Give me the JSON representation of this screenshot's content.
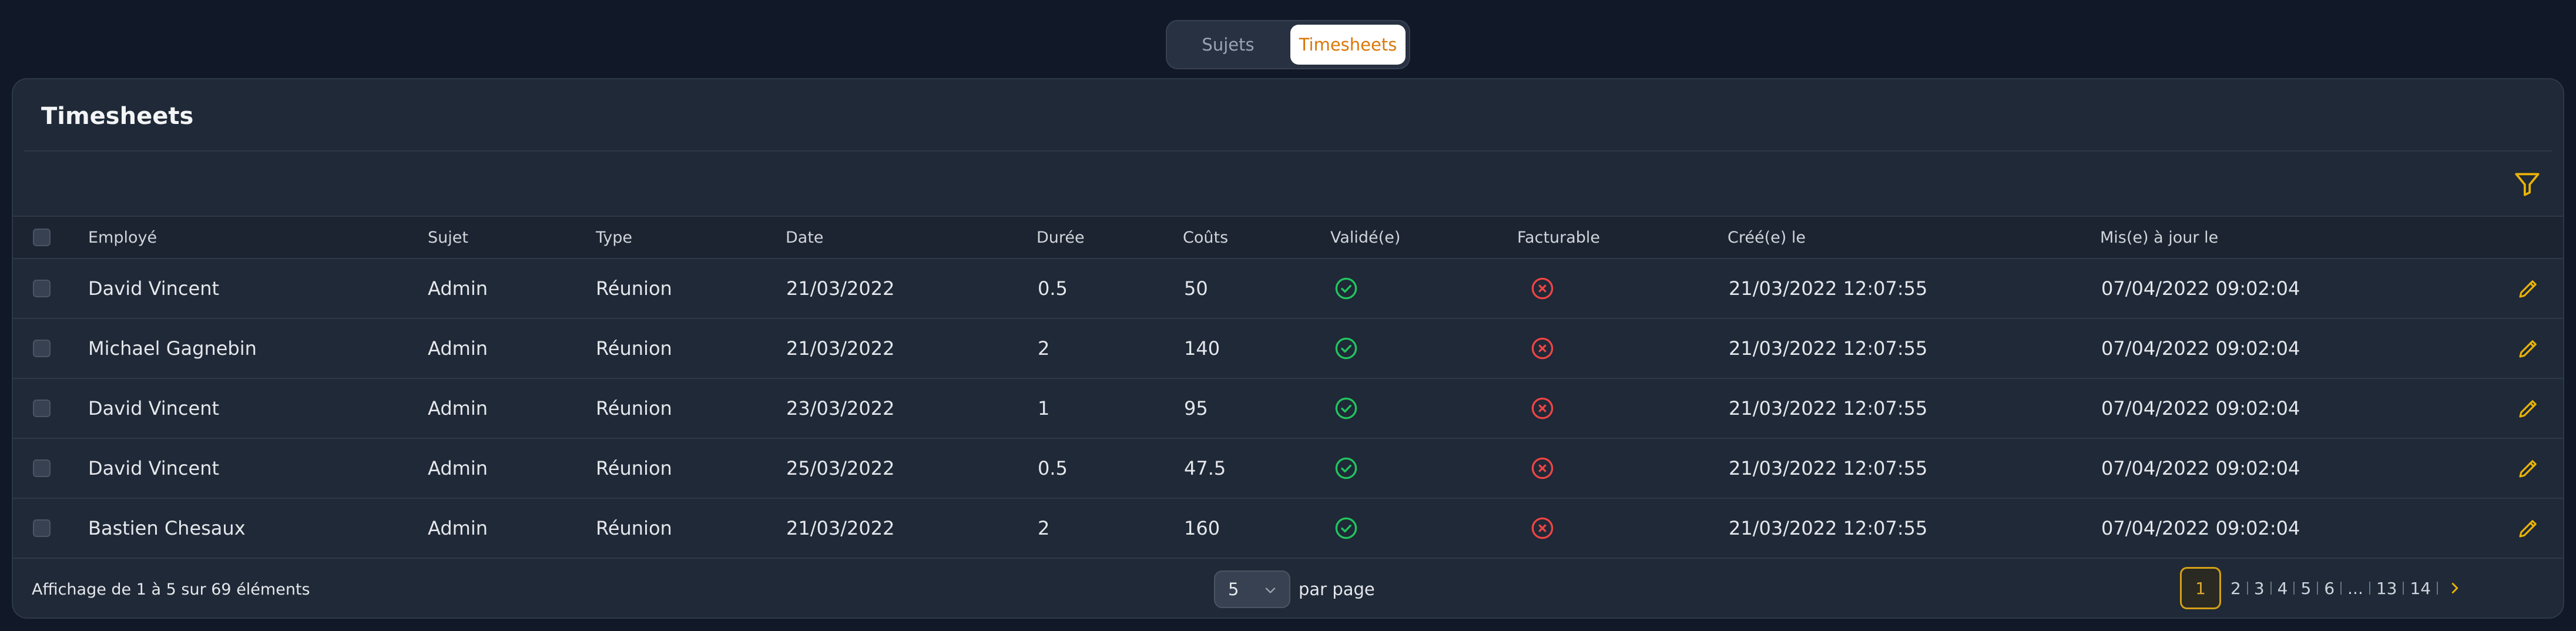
{
  "tabs": [
    {
      "label": "Sujets",
      "active": false
    },
    {
      "label": "Timesheets",
      "active": true
    }
  ],
  "card": {
    "title": "Timesheets"
  },
  "table": {
    "columns": [
      "Employé",
      "Sujet",
      "Type",
      "Date",
      "Durée",
      "Coûts",
      "Validé(e)",
      "Facturable",
      "Créé(e) le",
      "Mis(e) à jour le"
    ],
    "rows": [
      {
        "employe": "David Vincent",
        "sujet": "Admin",
        "type": "Réunion",
        "date": "21/03/2022",
        "duree": "0.5",
        "couts": "50",
        "cree": "21/03/2022 12:07:55",
        "maj": "07/04/2022 09:02:04"
      },
      {
        "employe": "Michael Gagnebin",
        "sujet": "Admin",
        "type": "Réunion",
        "date": "21/03/2022",
        "duree": "2",
        "couts": "140",
        "cree": "21/03/2022 12:07:55",
        "maj": "07/04/2022 09:02:04"
      },
      {
        "employe": "David Vincent",
        "sujet": "Admin",
        "type": "Réunion",
        "date": "23/03/2022",
        "duree": "1",
        "couts": "95",
        "cree": "21/03/2022 12:07:55",
        "maj": "07/04/2022 09:02:04"
      },
      {
        "employe": "David Vincent",
        "sujet": "Admin",
        "type": "Réunion",
        "date": "25/03/2022",
        "duree": "0.5",
        "couts": "47.5",
        "cree": "21/03/2022 12:07:55",
        "maj": "07/04/2022 09:02:04"
      },
      {
        "employe": "Bastien Chesaux",
        "sujet": "Admin",
        "type": "Réunion",
        "date": "21/03/2022",
        "duree": "2",
        "couts": "160",
        "cree": "21/03/2022 12:07:55",
        "maj": "07/04/2022 09:02:04"
      }
    ]
  },
  "footer": {
    "summary": "Affichage de 1 à 5 sur 69 éléments",
    "per_page_value": "5",
    "per_page_label": "par page"
  },
  "pagination": {
    "pages": [
      "1",
      "2",
      "3",
      "4",
      "5",
      "6",
      "...",
      "13",
      "14"
    ],
    "current": "1"
  },
  "colors": {
    "accent": "#d97706",
    "valid": "#22c55e",
    "invalid": "#ef4444",
    "edit": "#eab308"
  },
  "icons": {
    "validated": "check-circle-icon",
    "not_billable": "x-circle-icon",
    "edit": "pencil-icon",
    "filter": "filter-icon",
    "next": "chevron-right-icon",
    "select": "chevron-down-icon"
  }
}
